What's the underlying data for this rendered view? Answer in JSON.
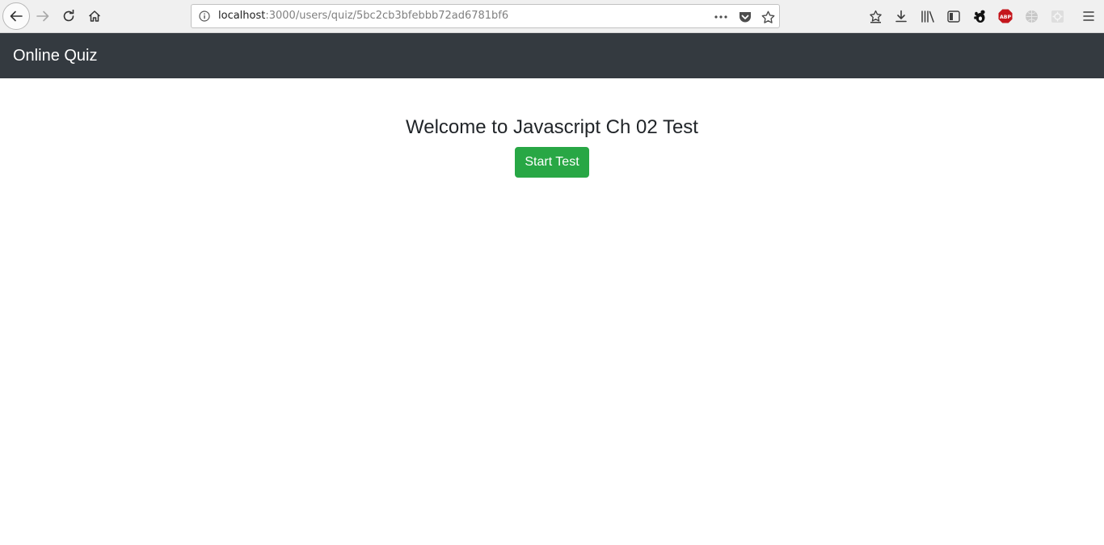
{
  "browser": {
    "url_host": "localhost",
    "url_rest": ":3000/users/quiz/5bc2cb3bfebbb72ad6781bf6",
    "icons": [
      "back-icon",
      "forward-icon",
      "reload-icon",
      "home-icon",
      "info-icon",
      "more-icon",
      "pocket-icon",
      "star-icon",
      "bookmarks-icon",
      "download-icon",
      "library-icon",
      "sidebar-icon",
      "gnome-icon",
      "adblock-icon",
      "globe-icon",
      "extension-icon",
      "menu-icon"
    ],
    "adblock_label": "ABP",
    "colors": {
      "adblock": "#c4161c"
    }
  },
  "navbar": {
    "brand": "Online Quiz",
    "background": "#343a40"
  },
  "main": {
    "welcome": "Welcome to Javascript Ch 02 Test",
    "start_button": "Start Test",
    "button_color": "#28a745"
  }
}
